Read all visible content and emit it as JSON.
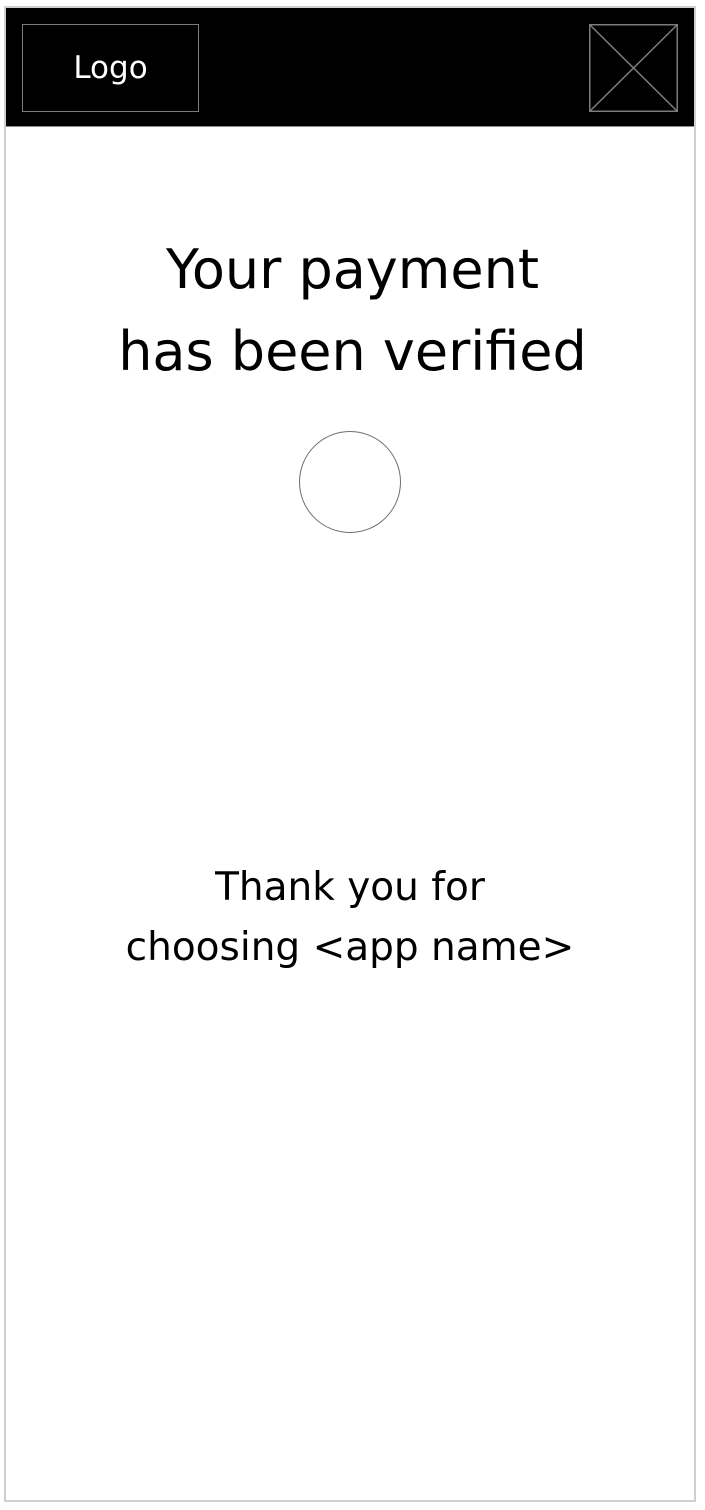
{
  "header": {
    "logo_label": "Logo"
  },
  "main": {
    "title_line_1": "Your payment",
    "title_line_2": "has been verified",
    "thanks_line_1": "Thank you for",
    "thanks_line_2": "choosing <app name>"
  },
  "icons": {
    "header_image": "image-placeholder-icon",
    "status": "status-circle-icon"
  },
  "colors": {
    "header_bg": "#000000",
    "placeholder_stroke": "#7c7c7c",
    "text": "#000000",
    "background": "#ffffff"
  }
}
